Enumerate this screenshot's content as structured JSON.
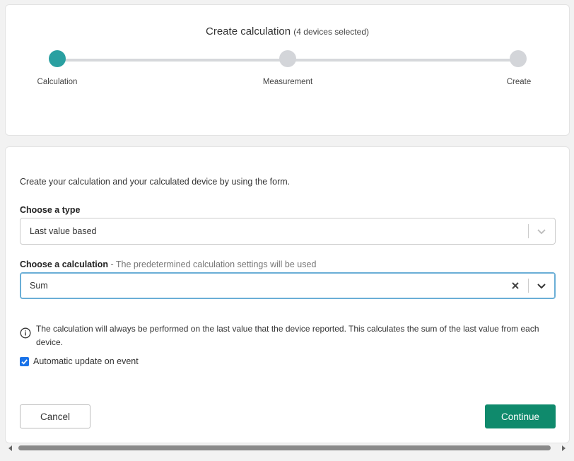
{
  "stepper": {
    "title": "Create calculation",
    "subtitle": "(4 devices selected)",
    "steps": [
      {
        "label": "Calculation",
        "active": true
      },
      {
        "label": "Measurement",
        "active": false
      },
      {
        "label": "Create",
        "active": false
      }
    ]
  },
  "form": {
    "intro": "Create your calculation and your calculated device by using the form.",
    "type_label": "Choose a type",
    "type_value": "Last value based",
    "calc_label": "Choose a calculation",
    "calc_hint": " - The predetermined calculation settings will be used",
    "calc_value": "Sum",
    "info_text": "The calculation will always be performed on the last value that the device reported. This calculates the sum of the last value from each device.",
    "checkbox_label": "Automatic update on event",
    "checkbox_checked": true,
    "cancel_label": "Cancel",
    "continue_label": "Continue"
  },
  "icons": {
    "info": "info-circle-icon",
    "chevron": "chevron-down-icon",
    "clear": "close-icon",
    "check": "checkmark-icon"
  },
  "colors": {
    "active_step": "#2aa0a1",
    "inactive_step": "#d3d5d9",
    "primary_button": "#0f8a6c",
    "checkbox": "#1a73e8",
    "focus_border": "#6aaed6"
  }
}
